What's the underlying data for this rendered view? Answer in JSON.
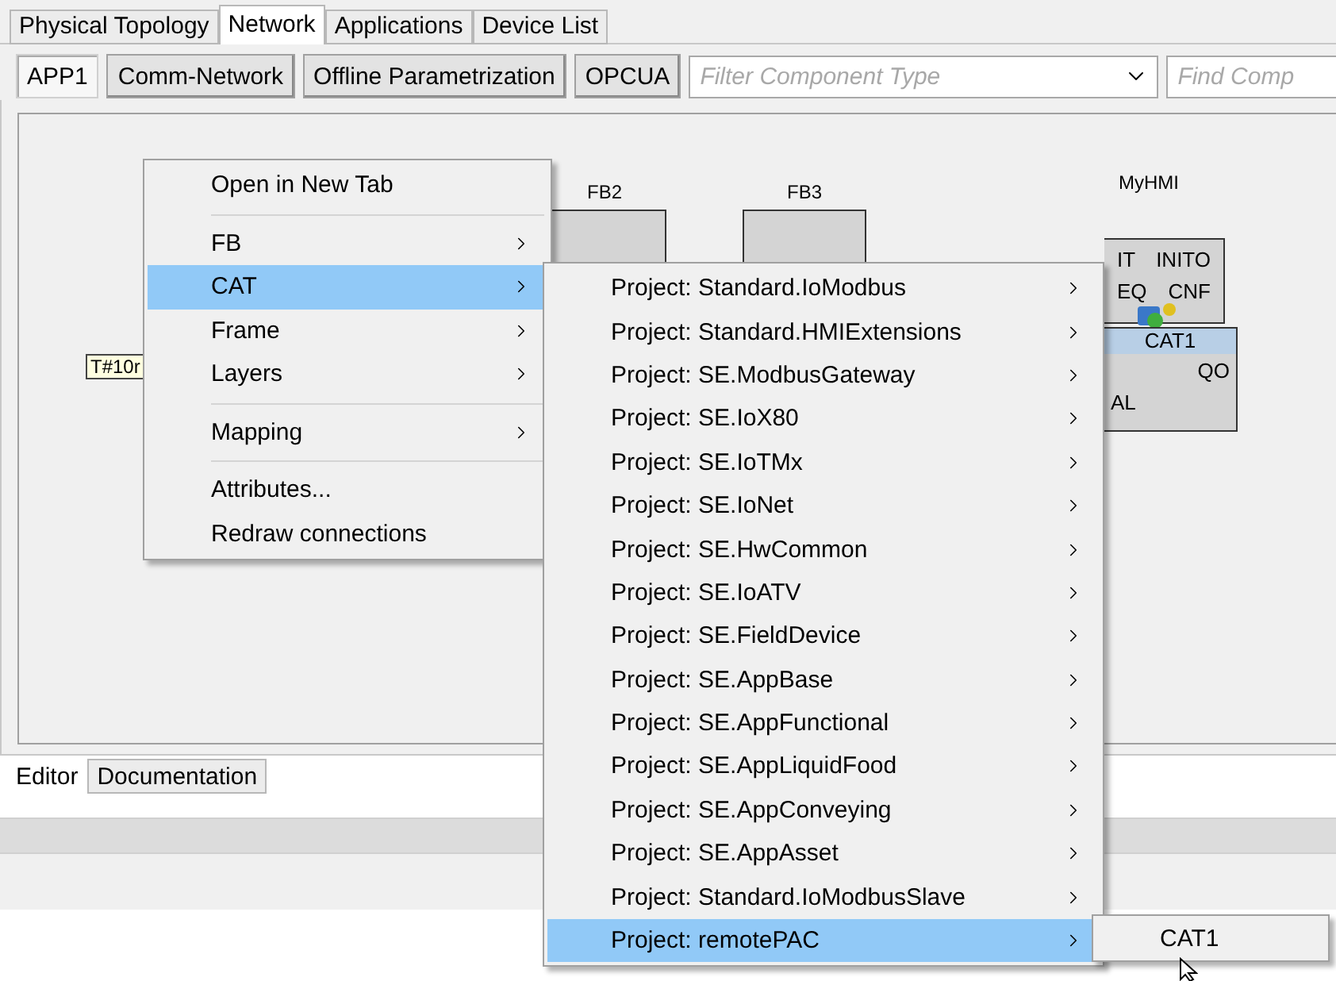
{
  "top_tabs": [
    {
      "label": "Physical Topology",
      "selected": false
    },
    {
      "label": "Network",
      "selected": true
    },
    {
      "label": "Applications",
      "selected": false
    },
    {
      "label": "Device List",
      "selected": false
    }
  ],
  "toolbar": {
    "buttons": [
      {
        "label": "APP1",
        "selected": true
      },
      {
        "label": "Comm-Network",
        "selected": false
      },
      {
        "label": "Offline Parametrization",
        "selected": false
      },
      {
        "label": "OPCUA",
        "selected": false
      }
    ],
    "filter": {
      "placeholder": "Filter Component Type"
    },
    "find": {
      "placeholder": "Find Comp"
    }
  },
  "canvas": {
    "constant": "T#10r",
    "blocks": [
      {
        "title": "FB2"
      },
      {
        "title": "FB3"
      }
    ],
    "hmi": {
      "title": "MyHMI",
      "instance": "CAT1",
      "upper_rows": [
        {
          "left": "IT",
          "right": "INITO"
        },
        {
          "left": "EQ",
          "right": "CNF"
        }
      ],
      "lower_rows": [
        {
          "right": "QO"
        },
        {
          "left": "AL"
        }
      ]
    }
  },
  "context_menu": {
    "items": [
      {
        "kind": "item",
        "label": "Open in New Tab",
        "submenu": false,
        "selected": false
      },
      {
        "kind": "separator"
      },
      {
        "kind": "item",
        "label": "FB",
        "submenu": true,
        "selected": false
      },
      {
        "kind": "item",
        "label": "CAT",
        "submenu": true,
        "selected": true
      },
      {
        "kind": "item",
        "label": "Frame",
        "submenu": true,
        "selected": false
      },
      {
        "kind": "item",
        "label": "Layers",
        "submenu": true,
        "selected": false
      },
      {
        "kind": "separator"
      },
      {
        "kind": "item",
        "label": "Mapping",
        "submenu": true,
        "selected": false
      },
      {
        "kind": "separator"
      },
      {
        "kind": "item",
        "label": "Attributes...",
        "submenu": false,
        "selected": false
      },
      {
        "kind": "item",
        "label": "Redraw connections",
        "submenu": false,
        "selected": false
      }
    ]
  },
  "cat_submenu": {
    "items": [
      {
        "label": "Project: Standard.IoModbus",
        "selected": false
      },
      {
        "label": "Project: Standard.HMIExtensions",
        "selected": false
      },
      {
        "label": "Project: SE.ModbusGateway",
        "selected": false
      },
      {
        "label": "Project: SE.IoX80",
        "selected": false
      },
      {
        "label": "Project: SE.IoTMx",
        "selected": false
      },
      {
        "label": "Project: SE.IoNet",
        "selected": false
      },
      {
        "label": "Project: SE.HwCommon",
        "selected": false
      },
      {
        "label": "Project: SE.IoATV",
        "selected": false
      },
      {
        "label": "Project: SE.FieldDevice",
        "selected": false
      },
      {
        "label": "Project: SE.AppBase",
        "selected": false
      },
      {
        "label": "Project: SE.AppFunctional",
        "selected": false
      },
      {
        "label": "Project: SE.AppLiquidFood",
        "selected": false
      },
      {
        "label": "Project: SE.AppConveying",
        "selected": false
      },
      {
        "label": "Project: SE.AppAsset",
        "selected": false
      },
      {
        "label": "Project: Standard.IoModbusSlave",
        "selected": false
      },
      {
        "label": "Project: remotePAC",
        "selected": true
      }
    ]
  },
  "project_submenu": {
    "items": [
      {
        "label": "CAT1",
        "selected": false
      }
    ]
  },
  "bottom_tabs": [
    {
      "label": "Editor",
      "selected": true
    },
    {
      "label": "Documentation",
      "selected": false
    }
  ]
}
